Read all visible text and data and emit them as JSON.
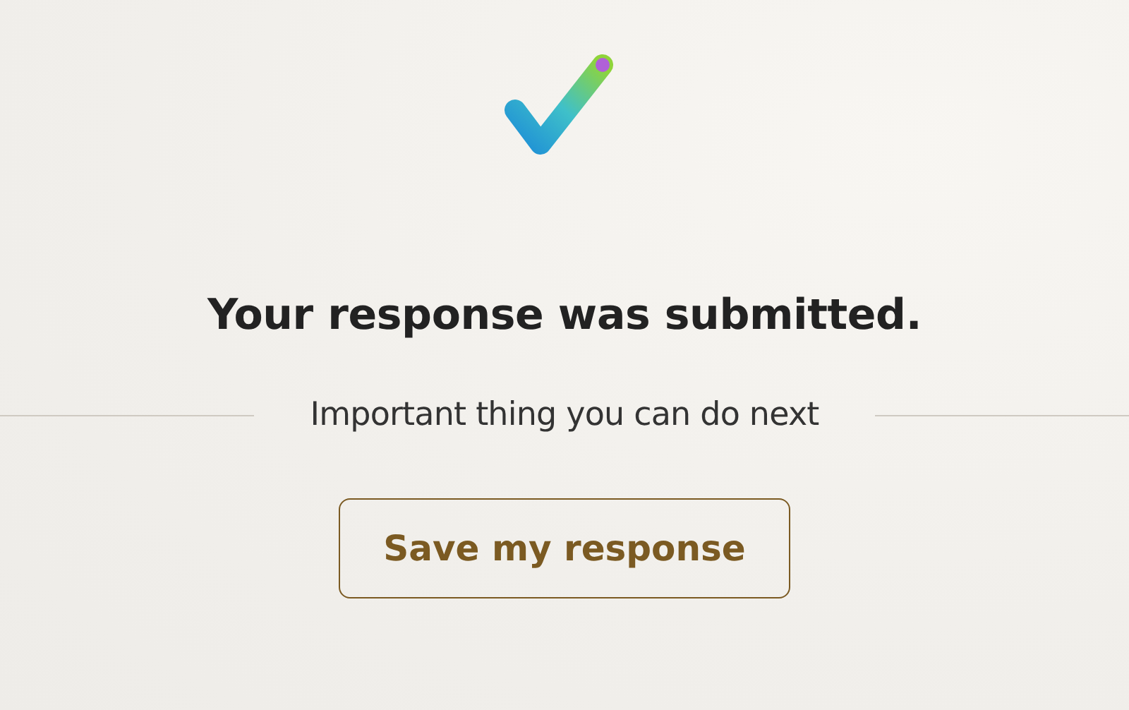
{
  "confirmation": {
    "title": "Your response was submitted."
  },
  "next_steps": {
    "heading": "Important thing you can do next"
  },
  "buttons": [
    {
      "label": "Save my response"
    }
  ]
}
